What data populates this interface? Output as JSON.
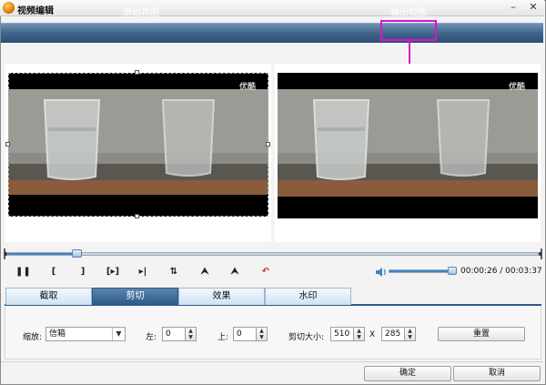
{
  "window": {
    "title": "视频编辑",
    "minimize": "–",
    "close": "✕"
  },
  "views": {
    "original_label": "原始视图",
    "output_label": "输出视图"
  },
  "video": {
    "watermark": "优酷"
  },
  "playback": {
    "progress_fraction": 0.13,
    "volume_fraction": 0.95,
    "time_readout": "00:00:26 / 00:03:37"
  },
  "transport": {
    "pause": "❚❚",
    "mark_in": "[",
    "mark_out": "]",
    "play_selection": "[▸]",
    "next_frame": "▸|",
    "flip_vertical": "⇅",
    "rotate_left": "⮝",
    "rotate_right": "⮝",
    "undo": "↶"
  },
  "tabs": [
    {
      "label": "截取",
      "active": false
    },
    {
      "label": "剪切",
      "active": true
    },
    {
      "label": "效果",
      "active": false
    },
    {
      "label": "水印",
      "active": false
    }
  ],
  "crop": {
    "zoom_label": "缩放:",
    "zoom_value": "信箱",
    "left_label": "左:",
    "left_value": "0",
    "top_label": "上:",
    "top_value": "0",
    "size_label": "剪切大小:",
    "width_value": "510",
    "times": "X",
    "height_value": "285",
    "reset_label": "重置"
  },
  "footer": {
    "ok_label": "确定",
    "cancel_label": "取消"
  },
  "colors": {
    "highlight": "#e011c9",
    "header_blue": "#3d6188",
    "accent": "#3c83cf"
  },
  "icons": {
    "app": "app-icon",
    "volume": "speaker-icon",
    "dropdown": "chevron-down-icon"
  }
}
